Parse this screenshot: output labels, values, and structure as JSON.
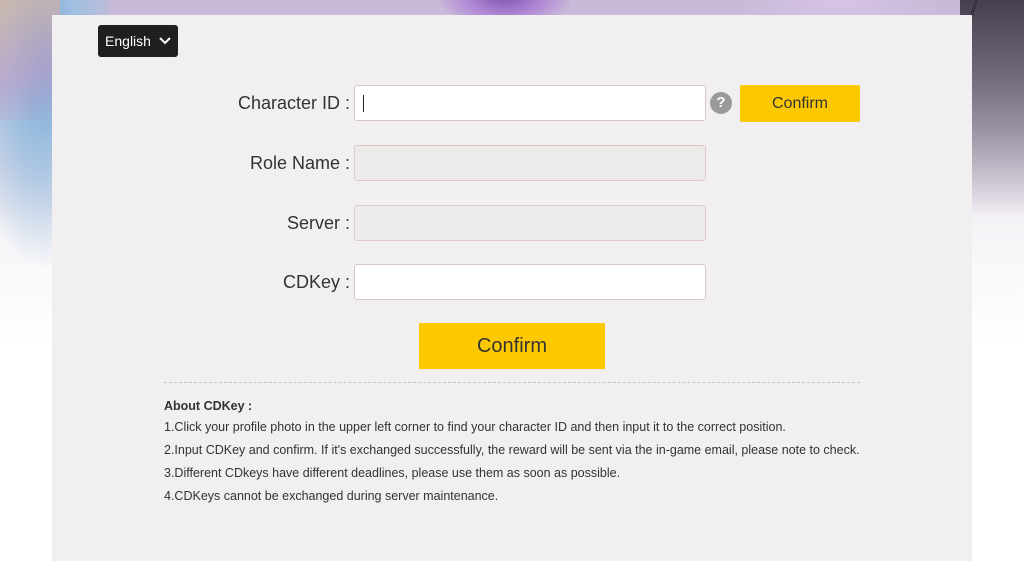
{
  "language": {
    "selected": "English"
  },
  "form": {
    "character_id": {
      "label": "Character ID :",
      "value": ""
    },
    "role_name": {
      "label": "Role Name :",
      "value": ""
    },
    "server": {
      "label": "Server :",
      "value": ""
    },
    "cdkey": {
      "label": "CDKey :",
      "value": ""
    },
    "help_icon": "?",
    "confirm_id_label": "Confirm",
    "confirm_label": "Confirm"
  },
  "about": {
    "title": "About CDKey :",
    "items": [
      "1.Click your profile photo in the upper left corner to find your character ID and then input it to the correct position.",
      "2.Input CDKey and confirm. If it's exchanged successfully, the reward will be sent via the in-game email, please note to check.",
      "3.Different CDkeys have different deadlines, please use them as soon as possible.",
      "4.CDKeys cannot be exchanged during server maintenance."
    ]
  },
  "colors": {
    "accent": "#fcc800",
    "dark": "#1f1f1f",
    "panel": "#f1efef"
  },
  "icons": {
    "language_dropdown": "chevron-down-icon",
    "help": "question-circle-icon"
  }
}
